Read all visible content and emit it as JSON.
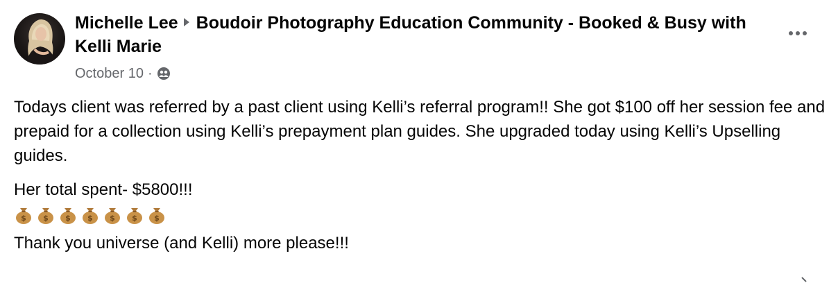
{
  "post": {
    "author": "Michelle Lee",
    "group": "Boudoir Photography Education Community - Booked & Busy with Kelli Marie",
    "date": "October 10",
    "separator": "·",
    "audience_icon": "group-audience-icon",
    "more_icon": "more-options-icon",
    "paragraphs": {
      "p1": "Todays client was referred by a past client using Kelli’s referral program!! She got $100 off her session fee and prepaid for a collection using Kelli’s prepayment plan guides. She upgraded today using Kelli’s Upselling guides.",
      "p2": "Her total spent- $5800!!!",
      "p3": "Thank you universe (and Kelli) more please!!!"
    },
    "emoji_icon": "money-bag-icon",
    "emoji_count": 7
  },
  "colors": {
    "text": "#050505",
    "secondary": "#65676b",
    "background": "#ffffff"
  }
}
